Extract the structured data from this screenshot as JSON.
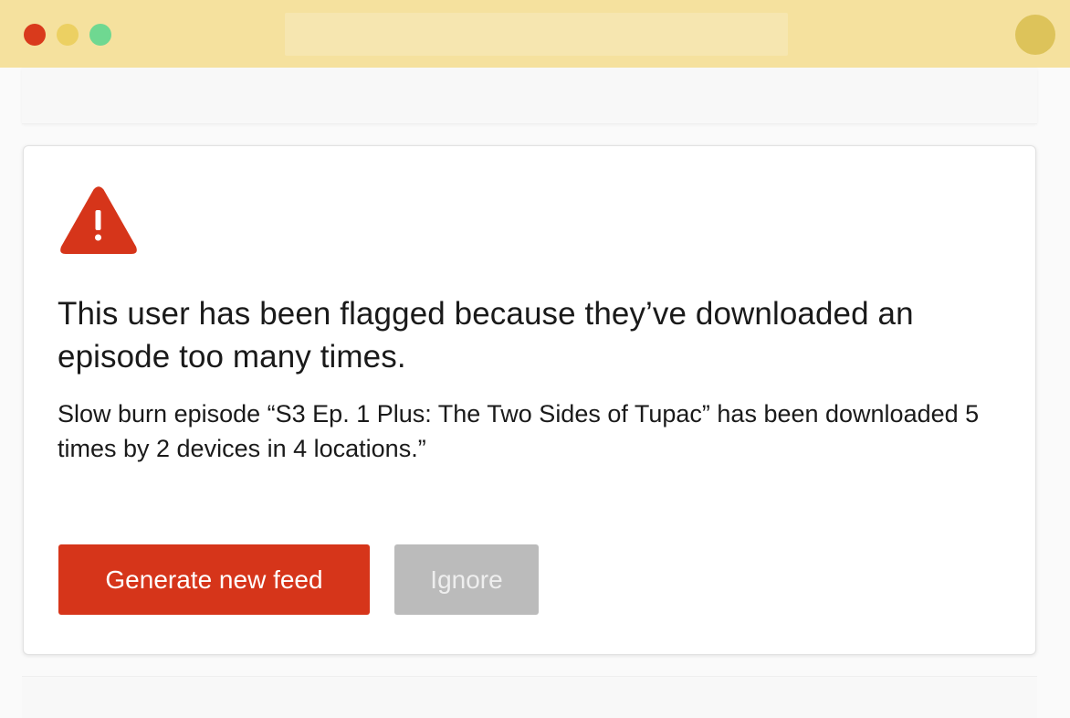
{
  "colors": {
    "titlebar": "#f5e19e",
    "close_dot": "#d93a1c",
    "minimize_dot": "#ecd062",
    "zoom_dot": "#6fd891",
    "profile_avatar": "#ddc35a",
    "alert_accent": "#d6351a",
    "primary_button": "#d6351a",
    "secondary_button": "#bbbbbb"
  },
  "alert": {
    "icon": "warning-triangle-icon",
    "title": "This user has been flagged because they’ve downloaded an episode too many times.",
    "body": "Slow burn episode “S3 Ep. 1 Plus: The Two Sides of Tupac” has been downloaded 5 times by 2 devices in 4 locations.”",
    "primary_button_label": "Generate new feed",
    "secondary_button_label": "Ignore"
  }
}
